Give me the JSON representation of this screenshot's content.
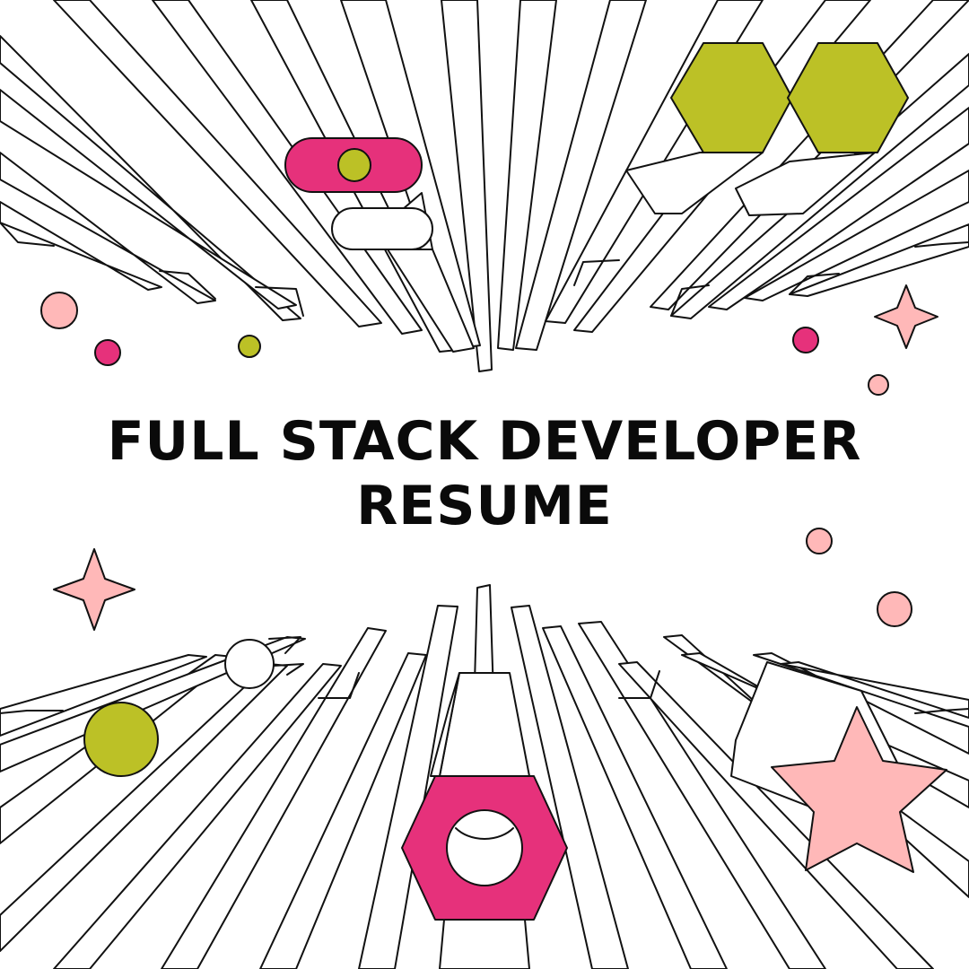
{
  "title": {
    "line1": "FULL STACK DEVELOPER",
    "line2": "RESUME"
  },
  "colors": {
    "background": "#ffffff",
    "outline": "#111111",
    "magenta": "#e6317b",
    "lime": "#bcc126",
    "pink": "#ffb8b8",
    "text": "#0a0a0a"
  },
  "decorations": {
    "top_pill_magenta": "pill-icon",
    "top_pill_white": "pill-icon",
    "top_hexagons": "hexagon-pair-icon",
    "bottom_hex_nut": "hex-nut-icon",
    "bottom_star": "star-icon",
    "sparkles": "sparkle-icon",
    "dots": "dot-icon"
  }
}
